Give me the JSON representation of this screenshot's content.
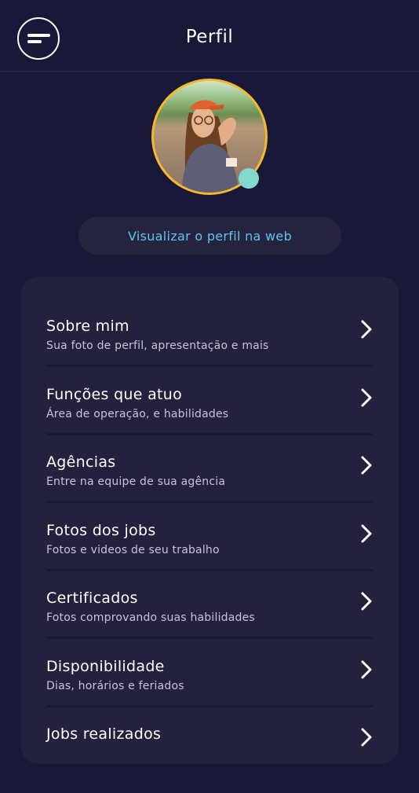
{
  "header": {
    "title": "Perfil"
  },
  "profile": {
    "web_link": "Visualizar o perfil na web"
  },
  "menu": {
    "items": [
      {
        "label": "Sobre mim",
        "sub": "Sua foto de perfil, apresentação e mais"
      },
      {
        "label": "Funções que atuo",
        "sub": "Área de operação, e habilidades"
      },
      {
        "label": "Agências",
        "sub": "Entre na equipe de sua agência"
      },
      {
        "label": "Fotos dos jobs",
        "sub": "Fotos e videos de seu trabalho"
      },
      {
        "label": "Certificados",
        "sub": "Fotos comprovando suas habilidades"
      },
      {
        "label": "Disponibilidade",
        "sub": "Dias, horários e feriados"
      },
      {
        "label": "Jobs realizados",
        "sub": ""
      }
    ]
  },
  "icons": {
    "menu": "menu-icon",
    "chevron": "chevron-right-icon"
  },
  "colors": {
    "background": "#1a1838",
    "card": "#24213f",
    "accent_link": "#5cc6f2",
    "avatar_ring": "#f5b82e",
    "status_dot": "#83d9cd"
  }
}
